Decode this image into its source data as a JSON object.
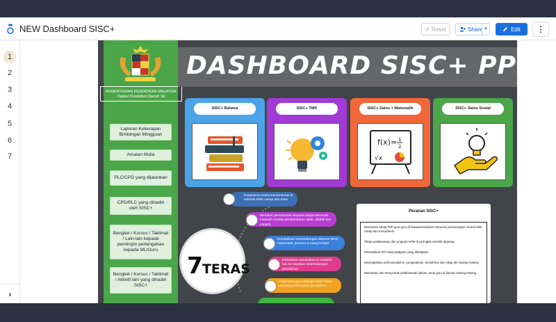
{
  "app": {
    "title": "NEW Dashboard SISC+",
    "reset_label": "Reset",
    "share_label": "Share",
    "edit_label": "Edit",
    "accent_color": "#1a6fe0"
  },
  "pages": [
    "1",
    "2",
    "3",
    "4",
    "5",
    "6",
    "7"
  ],
  "active_page": "1",
  "slide": {
    "title": "DASHBOARD SISC+ PPD SIK",
    "ministry_name": "KEMENTERIAN PENDIDIKAN MALAYSIA",
    "ministry_office": "Pejabat Pendidikan Daerah Sik",
    "menu": [
      "Laporan Kekerapan Bimbingan Mingguan",
      "Amalan Mulia",
      "PLC/CPD yang dijalankan",
      "CPD/PLC yang dihadiri oleh SISC+",
      "Bengkel / Kursus / Taklimat / Lain-lain kepada pemimpin pertengahan kepada ML/Guru",
      "Bengkel / Kursus / Taklimat / Aktiviti lain yang dihadiri SISC+"
    ],
    "cards": [
      {
        "label": "SISC+ Bahasa",
        "color": "#4ba3e8",
        "icon": "books-icon"
      },
      {
        "label": "SISC+ TMK",
        "color": "#a23bd6",
        "icon": "lightbulb-gear-icon"
      },
      {
        "label": "SISC+ Sains + Matematik",
        "color": "#f0683a",
        "icon": "math-board-icon"
      },
      {
        "label": "SISC+ Sains Sosial",
        "color": "#4aa649",
        "icon": "hand-lightbulb-icon"
      }
    ],
    "teras": {
      "title_number": "7",
      "title_word": "TERAS",
      "items": [
        {
          "text": "Kerjasama antara kementerian & sekolah lebih cekap dan telus",
          "color": "#3d6fb5"
        },
        {
          "text": "Memberi pemahaman kepada rakyat keramah insaniah melalui pembentukan adab, akhlak dan integriti",
          "color": "#b83ed1"
        },
        {
          "text": "Kembalikan keseimbangan dimensi BHG: matematik, persent & ruang belajar",
          "color": "#3a7fd9"
        },
        {
          "text": "Kesedaran pendidikan & masalah lalu ke sepakan keseimbangan pendidikan",
          "color": "#e03c8f"
        },
        {
          "text": "Kerjasama guru sebagai teras sebar peluang perkongsian pendidikan",
          "color": "#f2a21e"
        },
        {
          "text": "",
          "color": "#41b541"
        }
      ]
    },
    "fungsi": {
      "title": "Peranan SISC+",
      "items": [
        "Memantau tahap PdP guru-guru di kawasan/sekolah menerusi perancangan secara lebih cekap dan menyeluruh",
        "Tahap pelaksanaan dan program KPM di peringkat sekolah dipantau",
        "Memastikan KPI mata pelajaran yang ditetapkan",
        "Meningkatkan profesionalisme, pengetahuan, kemahiran dan sikap diri masing-masing",
        "Memantau dan menyemak pelaksanaan latihan untuk guru di daerah masing-masing"
      ]
    }
  }
}
